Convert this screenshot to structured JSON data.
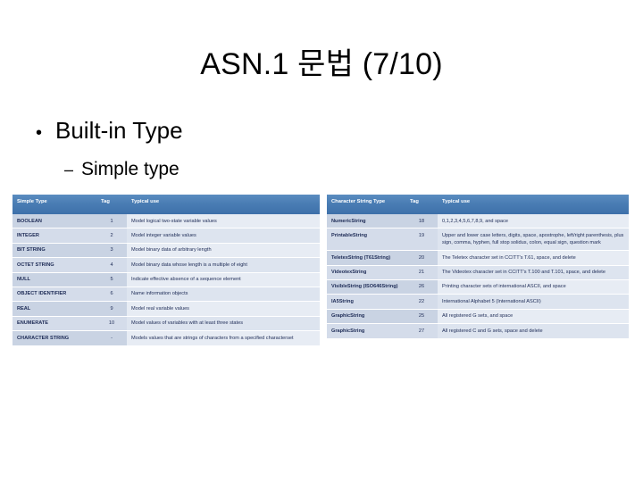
{
  "slide": {
    "title": "ASN.1 문법 (7/10)",
    "bullets": {
      "level1": {
        "marker": "•",
        "text": "Built-in Type"
      },
      "level2": {
        "marker": "–",
        "text": "Simple type"
      }
    }
  },
  "colors": {
    "header_blue": "#4a7db4",
    "row_tint": "#c9d3e3",
    "row_tint_alt": "#d4dcea",
    "use_tint": "#e7ecf4",
    "text_blue": "#1c2a55"
  },
  "simple_type_table": {
    "headers": [
      "Simple Type",
      "Tag",
      "Typical use"
    ],
    "rows": [
      {
        "name": "BOOLEAN",
        "tag": "1",
        "use": "Model logical two-state variable values"
      },
      {
        "name": "INTEGER",
        "tag": "2",
        "use": "Model integer variable values"
      },
      {
        "name": "BIT STRING",
        "tag": "3",
        "use": "Model binary data of arbitrary length"
      },
      {
        "name": "OCTET STRING",
        "tag": "4",
        "use": "Model binary data whose length is a multiple of eight"
      },
      {
        "name": "NULL",
        "tag": "5",
        "use": "Indicate effective absence of a sequence element"
      },
      {
        "name": "OBJECT IDENTIFIER",
        "tag": "6",
        "use": "Name information objects"
      },
      {
        "name": "REAL",
        "tag": "9",
        "use": "Model real variable values"
      },
      {
        "name": "ENUMERATE",
        "tag": "10",
        "use": "Model values of variables with at least three states"
      },
      {
        "name": "CHARACTER STRING",
        "tag": "-",
        "use": "Models values that are strings of characters from a specified characterset"
      }
    ]
  },
  "character_string_table": {
    "headers": [
      "Character String Type",
      "Tag",
      "Typical use"
    ],
    "rows": [
      {
        "name": "NumericString",
        "tag": "18",
        "use": "0,1,2,3,4,5,6,7,8,9, and space"
      },
      {
        "name": "PrintableString",
        "tag": "19",
        "use": "Upper and lower case letters, digits, space, apostrophe, left/right parenthesis, plus sign, comma, hyphen, full stop solidus, colon, equal sign, question mark"
      },
      {
        "name": "TeletexString (T61String)",
        "tag": "20",
        "use": "The Teletex character set in CCITT's T.61, space, and delete"
      },
      {
        "name": "VideotexString",
        "tag": "21",
        "use": "The Videotex character set in CCITT's T.100 and T.101, space, and delete"
      },
      {
        "name": "VisibleString (ISO646String)",
        "tag": "26",
        "use": "Printing character sets of international ASCII, and space"
      },
      {
        "name": "IA5String",
        "tag": "22",
        "use": "International Alphabet 5 (International ASCII)"
      },
      {
        "name": "GraphicString",
        "tag": "25",
        "use": "All registered G sets, and space"
      },
      {
        "name": "GraphicString",
        "tag": "27",
        "use": "All registered C and G sets, space and delete"
      }
    ]
  }
}
